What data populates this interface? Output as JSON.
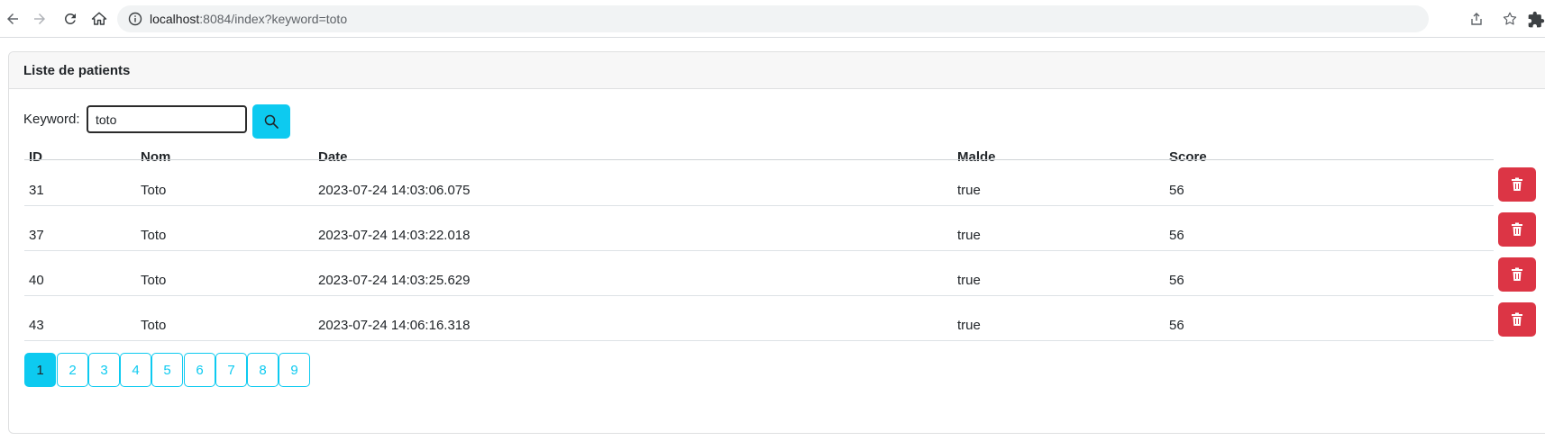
{
  "browser": {
    "url_host": "localhost",
    "url_rest": ":8084/index?keyword=toto"
  },
  "card": {
    "title": "Liste de patients"
  },
  "search": {
    "label": "Keyword:",
    "value": "toto"
  },
  "table": {
    "headers": [
      "ID",
      "Nom",
      "Date",
      "Malde",
      "Score"
    ],
    "rows": [
      {
        "id": "31",
        "nom": "Toto",
        "date": "2023-07-24 14:03:06.075",
        "malade": "true",
        "score": "56"
      },
      {
        "id": "37",
        "nom": "Toto",
        "date": "2023-07-24 14:03:22.018",
        "malade": "true",
        "score": "56"
      },
      {
        "id": "40",
        "nom": "Toto",
        "date": "2023-07-24 14:03:25.629",
        "malade": "true",
        "score": "56"
      },
      {
        "id": "43",
        "nom": "Toto",
        "date": "2023-07-24 14:06:16.318",
        "malade": "true",
        "score": "56"
      }
    ]
  },
  "pagination": {
    "pages": [
      "1",
      "2",
      "3",
      "4",
      "5",
      "6",
      "7",
      "8",
      "9"
    ],
    "current": "1"
  },
  "colors": {
    "accent": "#0dcaf0",
    "danger": "#dc3545"
  }
}
